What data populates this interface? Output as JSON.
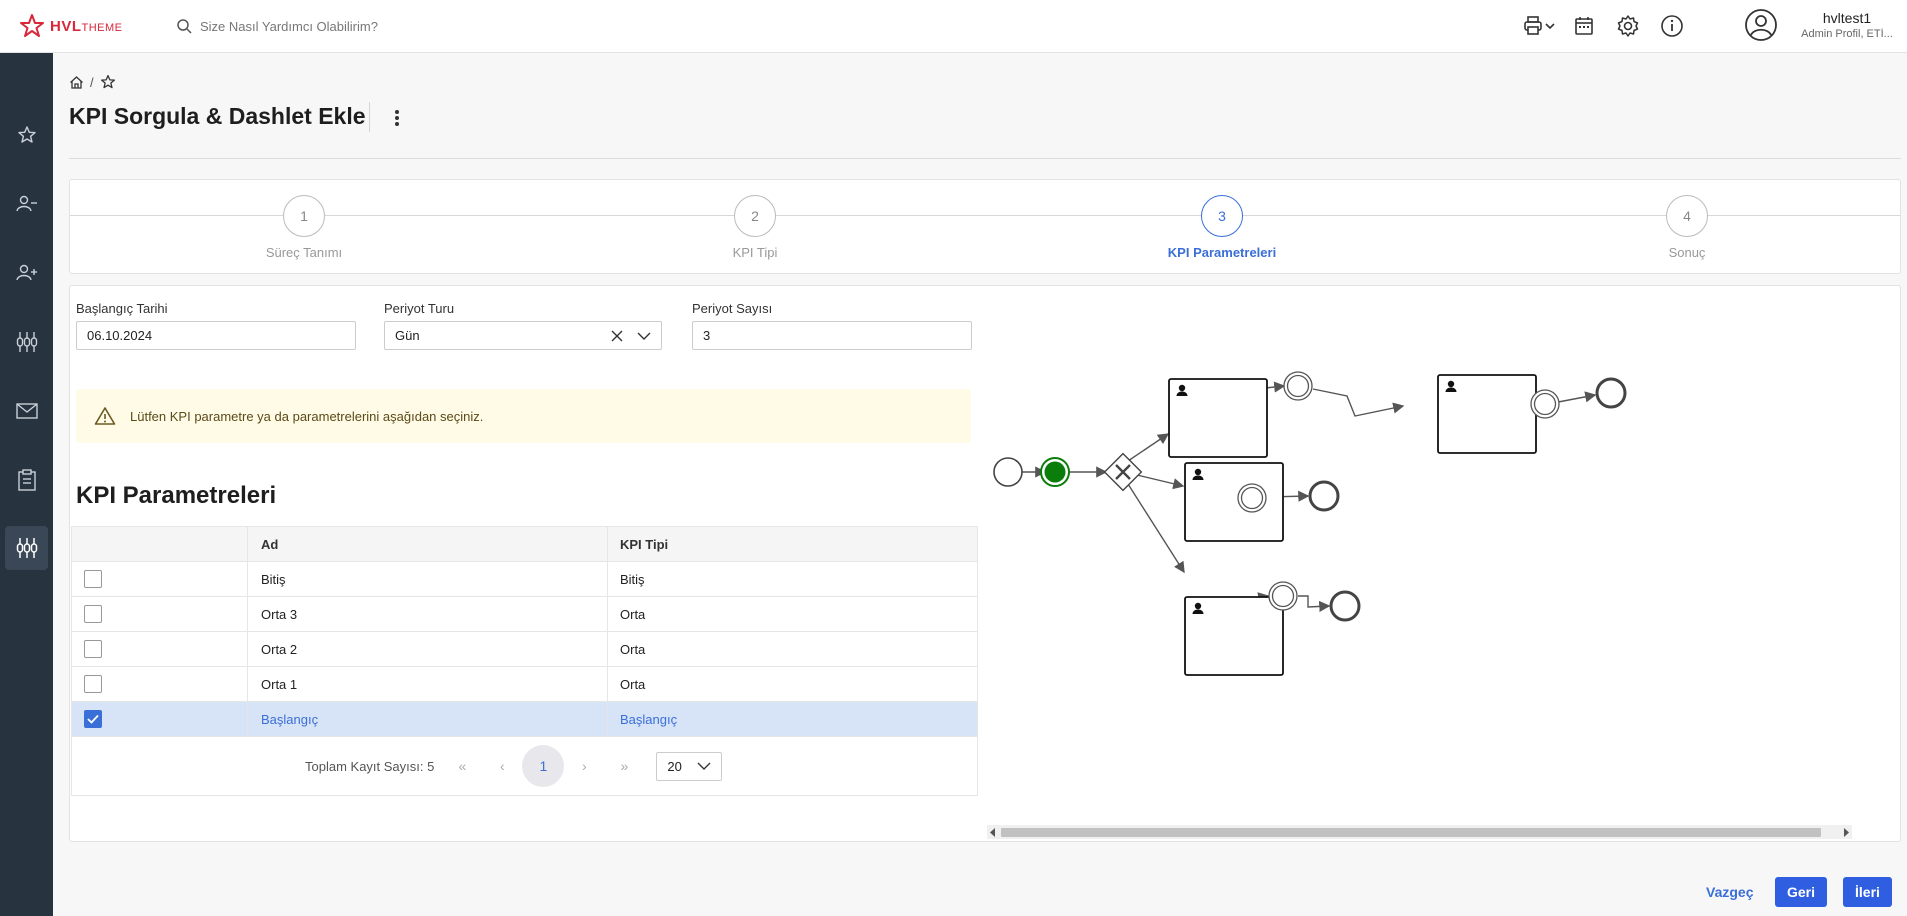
{
  "header": {
    "brand": "HVL",
    "brand_suffix": "THEME",
    "search_placeholder": "Size Nasıl Yardımcı Olabilirim?",
    "user_name": "hvltest1",
    "user_sub": "Admin Profil, ETİ..."
  },
  "breadcrumb": {
    "sep": "/"
  },
  "page": {
    "title": "KPI Sorgula & Dashlet Ekle"
  },
  "stepper": {
    "steps": [
      {
        "num": "1",
        "label": "Süreç Tanımı"
      },
      {
        "num": "2",
        "label": "KPI Tipi"
      },
      {
        "num": "3",
        "label": "KPI Parametreleri"
      },
      {
        "num": "4",
        "label": "Sonuç"
      }
    ]
  },
  "form": {
    "start_label": "Başlangıç Tarihi",
    "start_value": "06.10.2024",
    "period_type_label": "Periyot Turu",
    "period_type_value": "Gün",
    "period_count_label": "Periyot Sayısı",
    "period_count_value": "3"
  },
  "alert": {
    "text": "Lütfen KPI parametre ya da parametrelerini aşağıdan seçiniz."
  },
  "params": {
    "title": "KPI Parametreleri",
    "col_name": "Ad",
    "col_type": "KPI Tipi",
    "rows": [
      {
        "name": "Bitiş",
        "type": "Bitiş",
        "checked": false
      },
      {
        "name": "Orta 3",
        "type": "Orta",
        "checked": false
      },
      {
        "name": "Orta 2",
        "type": "Orta",
        "checked": false
      },
      {
        "name": "Orta 1",
        "type": "Orta",
        "checked": false
      },
      {
        "name": "Başlangıç",
        "type": "Başlangıç",
        "checked": true
      }
    ],
    "total_label": "Toplam Kayıt Sayısı: 5",
    "first": "«",
    "prev": "‹",
    "page": "1",
    "next": "›",
    "last": "»",
    "page_size": "20"
  },
  "footer": {
    "cancel": "Vazgeç",
    "back": "Geri",
    "next": "İleri"
  },
  "colors": {
    "accent": "#3b6fd8",
    "sidebar": "#283340",
    "brand": "#d8283b",
    "active_event": "#0a7d0a"
  }
}
